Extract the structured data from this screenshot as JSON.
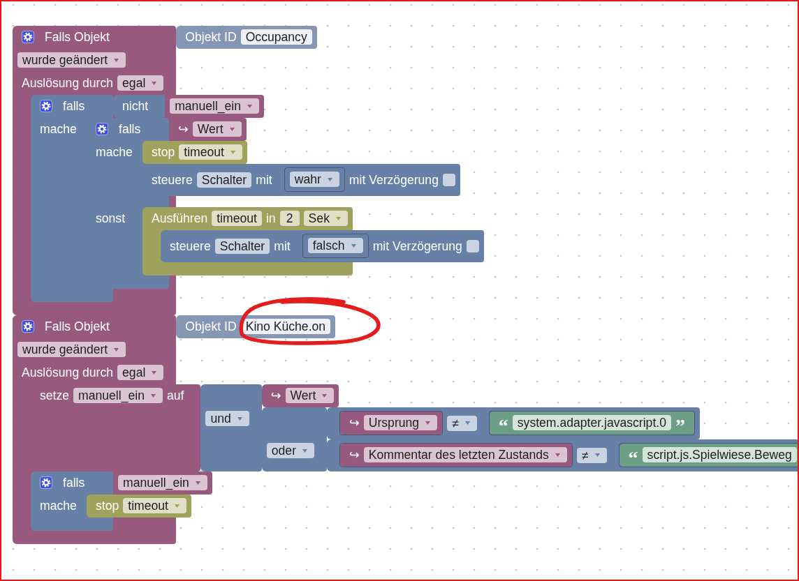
{
  "workspace": {
    "blocks": [
      {
        "kind": "event",
        "rows": [
          {
            "kind": "value",
            "items": [
              {
                "kind": "gear"
              },
              {
                "kind": "label",
                "text": "Falls Objekt"
              }
            ],
            "input": {
              "kind": "object_id",
              "rows": [
                {
                  "kind": "value",
                  "items": [
                    {
                      "kind": "label",
                      "text": "Objekt ID"
                    },
                    {
                      "kind": "field",
                      "text": "Occupancy",
                      "circled": false
                    }
                  ]
                }
              ]
            }
          },
          {
            "kind": "value",
            "items": [
              {
                "kind": "dropdown",
                "text": "wurde geändert"
              }
            ]
          },
          {
            "kind": "value",
            "items": [
              {
                "kind": "label",
                "text": "Auslösung durch"
              },
              {
                "kind": "dropdown",
                "text": "egal"
              }
            ]
          },
          {
            "kind": "statement",
            "blocks": [
              {
                "kind": "logic",
                "rows": [
                  {
                    "kind": "value",
                    "items": [
                      {
                        "kind": "gear"
                      },
                      {
                        "kind": "label",
                        "text": "falls"
                      }
                    ],
                    "input": {
                      "kind": "logic",
                      "rows": [
                        {
                          "kind": "value",
                          "items": [
                            {
                              "kind": "label",
                              "text": "nicht"
                            }
                          ],
                          "input": {
                            "kind": "variable",
                            "rows": [
                              {
                                "kind": "value",
                                "items": [
                                  {
                                    "kind": "dropdown",
                                    "text": "manuell_ein"
                                  }
                                ]
                              }
                            ]
                          }
                        }
                      ]
                    }
                  },
                  {
                    "kind": "statement",
                    "label": "mache",
                    "blocks": [
                      {
                        "kind": "logic",
                        "rows": [
                          {
                            "kind": "value",
                            "items": [
                              {
                                "kind": "gear"
                              },
                              {
                                "kind": "label",
                                "text": "falls"
                              }
                            ],
                            "input": {
                              "kind": "variable",
                              "rows": [
                                {
                                  "kind": "value",
                                  "items": [
                                    {
                                      "kind": "label",
                                      "text": "↪"
                                    },
                                    {
                                      "kind": "dropdown",
                                      "text": "Wert"
                                    }
                                  ]
                                }
                              ]
                            }
                          },
                          {
                            "kind": "statement",
                            "label": "mache",
                            "blocks": [
                              {
                                "kind": "timer",
                                "rows": [
                                  {
                                    "kind": "value",
                                    "items": [
                                      {
                                        "kind": "label",
                                        "text": "stop"
                                      },
                                      {
                                        "kind": "dropdown",
                                        "text": "timeout"
                                      }
                                    ]
                                  }
                                ]
                              },
                              {
                                "kind": "control",
                                "rows": [
                                  {
                                    "kind": "value",
                                    "items": [
                                      {
                                        "kind": "label",
                                        "text": "steuere"
                                      },
                                      {
                                        "kind": "field",
                                        "text": "Schalter"
                                      },
                                      {
                                        "kind": "label",
                                        "text": "mit"
                                      },
                                      {
                                        "kind": "inline",
                                        "block": {
                                          "kind": "logic",
                                          "rows": [
                                            {
                                              "kind": "value",
                                              "items": [
                                                {
                                                  "kind": "dropdown",
                                                  "text": "wahr"
                                                }
                                              ]
                                            }
                                          ]
                                        }
                                      },
                                      {
                                        "kind": "label",
                                        "text": "mit Verzögerung"
                                      },
                                      {
                                        "kind": "checkbox",
                                        "checked": false
                                      }
                                    ]
                                  }
                                ]
                              }
                            ]
                          },
                          {
                            "kind": "statement",
                            "label": "sonst",
                            "blocks": [
                              {
                                "kind": "timer",
                                "rows": [
                                  {
                                    "kind": "value",
                                    "items": [
                                      {
                                        "kind": "label",
                                        "text": "Ausführen"
                                      },
                                      {
                                        "kind": "field",
                                        "text": "timeout"
                                      },
                                      {
                                        "kind": "label",
                                        "text": "in"
                                      },
                                      {
                                        "kind": "field",
                                        "text": "2"
                                      },
                                      {
                                        "kind": "dropdown",
                                        "text": "Sek"
                                      }
                                    ]
                                  },
                                  {
                                    "kind": "statement",
                                    "blocks": [
                                      {
                                        "kind": "control",
                                        "rows": [
                                          {
                                            "kind": "value",
                                            "items": [
                                              {
                                                "kind": "label",
                                                "text": "steuere"
                                              },
                                              {
                                                "kind": "field",
                                                "text": "Schalter"
                                              },
                                              {
                                                "kind": "label",
                                                "text": "mit"
                                              },
                                              {
                                                "kind": "inline",
                                                "block": {
                                                  "kind": "logic",
                                                  "rows": [
                                                    {
                                                      "kind": "value",
                                                      "items": [
                                                        {
                                                          "kind": "dropdown",
                                                          "text": "falsch"
                                                        }
                                                      ]
                                                    }
                                                  ]
                                                }
                                              },
                                              {
                                                "kind": "label",
                                                "text": "mit Verzögerung"
                                              },
                                              {
                                                "kind": "checkbox",
                                                "checked": false
                                              }
                                            ]
                                          }
                                        ]
                                      }
                                    ]
                                  }
                                ]
                              }
                            ]
                          }
                        ]
                      }
                    ]
                  }
                ]
              }
            ]
          }
        ]
      },
      {
        "kind": "event",
        "rows": [
          {
            "kind": "value",
            "items": [
              {
                "kind": "gear"
              },
              {
                "kind": "label",
                "text": "Falls Objekt"
              }
            ],
            "input": {
              "kind": "object_id",
              "rows": [
                {
                  "kind": "value",
                  "items": [
                    {
                      "kind": "label",
                      "text": "Objekt ID"
                    },
                    {
                      "kind": "field",
                      "text": "Kino Küche.on",
                      "circled": true
                    }
                  ]
                }
              ]
            }
          },
          {
            "kind": "value",
            "items": [
              {
                "kind": "dropdown",
                "text": "wurde geändert"
              }
            ]
          },
          {
            "kind": "value",
            "items": [
              {
                "kind": "label",
                "text": "Auslösung durch"
              },
              {
                "kind": "dropdown",
                "text": "egal"
              }
            ]
          },
          {
            "kind": "statement",
            "blocks": [
              {
                "kind": "variable",
                "rows": [
                  {
                    "kind": "value",
                    "items": [
                      {
                        "kind": "label",
                        "text": "setze"
                      },
                      {
                        "kind": "dropdown",
                        "text": "manuell_ein"
                      },
                      {
                        "kind": "label",
                        "text": "auf"
                      }
                    ],
                    "input": {
                      "kind": "logic",
                      "rows": [
                        {
                          "kind": "value",
                          "input": {
                            "kind": "variable",
                            "rows": [
                              {
                                "kind": "value",
                                "items": [
                                  {
                                    "kind": "label",
                                    "text": "↪"
                                  },
                                  {
                                    "kind": "dropdown",
                                    "text": "Wert"
                                  }
                                ]
                              }
                            ]
                          }
                        },
                        {
                          "kind": "value",
                          "items": [
                            {
                              "kind": "dropdown",
                              "text": "und"
                            }
                          ],
                          "input": {
                            "kind": "logic",
                            "rows": [
                              {
                                "kind": "value",
                                "input": {
                                  "kind": "logic",
                                  "rows": [
                                    {
                                      "kind": "value",
                                      "items": [
                                        {
                                          "kind": "inline",
                                          "block": {
                                            "kind": "variable",
                                            "rows": [
                                              {
                                                "kind": "value",
                                                "items": [
                                                  {
                                                    "kind": "label",
                                                    "text": "↪"
                                                  },
                                                  {
                                                    "kind": "dropdown",
                                                    "text": "Ursprung"
                                                  }
                                                ]
                                              }
                                            ]
                                          }
                                        },
                                        {
                                          "kind": "dropdown",
                                          "text": "≠"
                                        },
                                        {
                                          "kind": "inline",
                                          "block": {
                                            "kind": "text",
                                            "rows": [
                                              {
                                                "kind": "value",
                                                "items": [
                                                  {
                                                    "kind": "quote",
                                                    "text": "“"
                                                  },
                                                  {
                                                    "kind": "field",
                                                    "text": "system.adapter.javascript.0"
                                                  },
                                                  {
                                                    "kind": "quote",
                                                    "text": "”"
                                                  }
                                                ]
                                              }
                                            ]
                                          }
                                        }
                                      ]
                                    }
                                  ]
                                }
                              },
                              {
                                "kind": "value",
                                "items": [
                                  {
                                    "kind": "dropdown",
                                    "text": "oder"
                                  }
                                ],
                                "input": {
                                  "kind": "logic",
                                  "rows": [
                                    {
                                      "kind": "value",
                                      "items": [
                                        {
                                          "kind": "inline",
                                          "block": {
                                            "kind": "variable",
                                            "rows": [
                                              {
                                                "kind": "value",
                                                "items": [
                                                  {
                                                    "kind": "label",
                                                    "text": "↪"
                                                  },
                                                  {
                                                    "kind": "dropdown",
                                                    "text": "Kommentar des letzten Zustands"
                                                  }
                                                ]
                                              }
                                            ]
                                          }
                                        },
                                        {
                                          "kind": "dropdown",
                                          "text": "≠"
                                        },
                                        {
                                          "kind": "inline",
                                          "block": {
                                            "kind": "text",
                                            "rows": [
                                              {
                                                "kind": "value",
                                                "items": [
                                                  {
                                                    "kind": "quote",
                                                    "text": "“"
                                                  },
                                                  {
                                                    "kind": "field",
                                                    "text": "script.js.Spielwiese.Beweg"
                                                  }
                                                ]
                                              }
                                            ]
                                          }
                                        }
                                      ]
                                    }
                                  ]
                                }
                              }
                            ]
                          }
                        }
                      ]
                    }
                  }
                ]
              },
              {
                "kind": "logic",
                "rows": [
                  {
                    "kind": "value",
                    "items": [
                      {
                        "kind": "gear"
                      },
                      {
                        "kind": "label",
                        "text": "falls"
                      }
                    ],
                    "input": {
                      "kind": "variable",
                      "rows": [
                        {
                          "kind": "value",
                          "items": [
                            {
                              "kind": "dropdown",
                              "text": "manuell_ein"
                            }
                          ]
                        }
                      ]
                    }
                  },
                  {
                    "kind": "statement",
                    "label": "mache",
                    "blocks": [
                      {
                        "kind": "timer",
                        "rows": [
                          {
                            "kind": "value",
                            "items": [
                              {
                                "kind": "label",
                                "text": "stop"
                              },
                              {
                                "kind": "dropdown",
                                "text": "timeout"
                              }
                            ]
                          }
                        ]
                      }
                    ]
                  }
                ]
              }
            ]
          }
        ]
      }
    ]
  }
}
